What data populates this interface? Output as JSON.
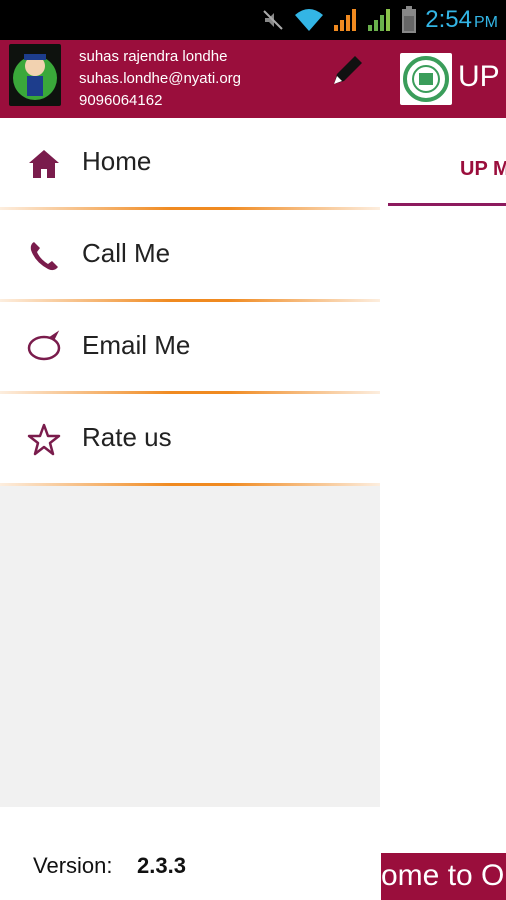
{
  "status_bar": {
    "time": "2:54",
    "ampm": "PM",
    "icons": [
      "mute-icon",
      "wifi-icon",
      "signal-icon",
      "signal-icon-2",
      "battery-icon"
    ],
    "time_color": "#33b5e5"
  },
  "drawer": {
    "header": {
      "name": "suhas rajendra londhe",
      "email": "suhas.londhe@nyati.org",
      "phone": "9096064162",
      "edit_icon": "pencil-icon"
    },
    "items": [
      {
        "label": "Home",
        "icon": "home-icon"
      },
      {
        "label": "Call Me",
        "icon": "phone-icon"
      },
      {
        "label": "Email Me",
        "icon": "speech-bubble-icon"
      },
      {
        "label": "Rate us",
        "icon": "star-icon"
      }
    ],
    "version_label": "Version:",
    "version_value": "2.3.3"
  },
  "background_app": {
    "title": "UP I",
    "tab_label": "UP M",
    "banner_text": "ome to O"
  },
  "colors": {
    "brand": "#9a0e3c",
    "accent": "#8c1a5e",
    "separator": "#f08a20"
  }
}
